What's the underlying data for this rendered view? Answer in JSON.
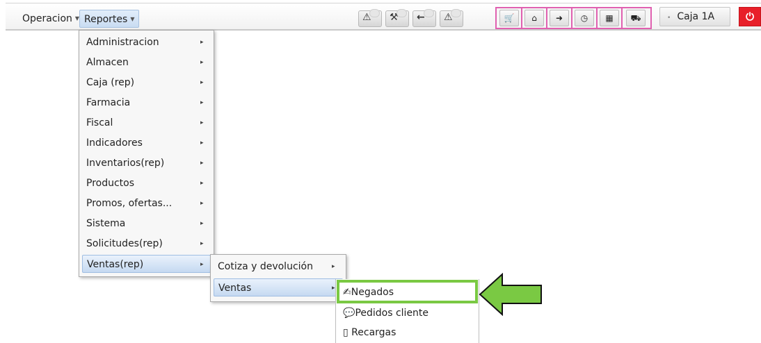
{
  "menubar": {
    "operacion_label": "Operacion",
    "reportes_label": "Reportes"
  },
  "toolbar": {
    "alert_icons": [
      "warning-icon",
      "tools-icon",
      "arrow-left-icon",
      "warning-icon"
    ],
    "pink_group_icons": [
      "cart-icon",
      "home-icon",
      "login-icon",
      "clock-icon",
      "calculator-icon",
      "truck-icon"
    ],
    "caja_label": "Caja 1A",
    "power_icon": "power-icon",
    "colors": {
      "pink_border": "#e060b0",
      "power_red": "#e8202a"
    }
  },
  "reportes_menu": {
    "items": [
      {
        "label": "Administracion"
      },
      {
        "label": "Almacen"
      },
      {
        "label": "Caja (rep)"
      },
      {
        "label": "Farmacia"
      },
      {
        "label": "Fiscal"
      },
      {
        "label": "Indicadores"
      },
      {
        "label": "Inventarios(rep)"
      },
      {
        "label": "Productos"
      },
      {
        "label": "Promos, ofertas..."
      },
      {
        "label": "Sistema"
      },
      {
        "label": "Solicitudes(rep)"
      },
      {
        "label": "Ventas(rep)"
      }
    ],
    "highlighted": "Ventas(rep)"
  },
  "ventas_rep_menu": {
    "items": [
      {
        "label": "Cotiza y devolución"
      },
      {
        "label": "Ventas"
      }
    ],
    "highlighted": "Ventas"
  },
  "ventas_menu": {
    "items": [
      {
        "label": "Negados",
        "icon": "signature-icon"
      },
      {
        "label": "Pedidos cliente",
        "icon": "speech-bubble-icon"
      },
      {
        "label": "Recargas",
        "icon": "phone-icon"
      }
    ]
  },
  "annotation": {
    "highlight_color": "#7ac943",
    "arrow_color": "#7ac943"
  }
}
